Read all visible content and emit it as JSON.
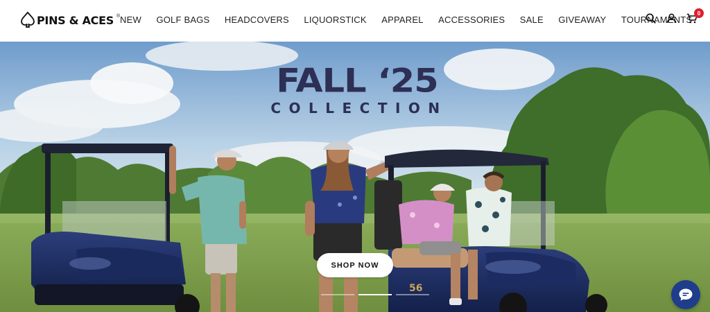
{
  "brand": {
    "name": "PINS & ACES",
    "registered_mark": "®",
    "logo_icon": "spade-icon"
  },
  "nav": {
    "items": [
      {
        "label": "NEW"
      },
      {
        "label": "GOLF BAGS"
      },
      {
        "label": "HEADCOVERS"
      },
      {
        "label": "LIQUORSTICK"
      },
      {
        "label": "APPAREL"
      },
      {
        "label": "ACCESSORIES"
      },
      {
        "label": "SALE"
      },
      {
        "label": "GIVEAWAY"
      },
      {
        "label": "TOURNAMENTS"
      }
    ]
  },
  "header_icons": {
    "search": "search-icon",
    "account": "user-icon",
    "cart": "cart-icon",
    "cart_count": "0"
  },
  "hero": {
    "title_line1": "FALL ‘25",
    "title_line2": "COLLECTION",
    "cta_label": "SHOP NOW",
    "slide_count": 3,
    "active_slide": 2
  },
  "chat": {
    "icon": "chat-bubble-icon"
  },
  "colors": {
    "title_navy": "#2d2f55",
    "cart_badge": "#e01f2d",
    "chat_button": "#1f3d8a"
  }
}
